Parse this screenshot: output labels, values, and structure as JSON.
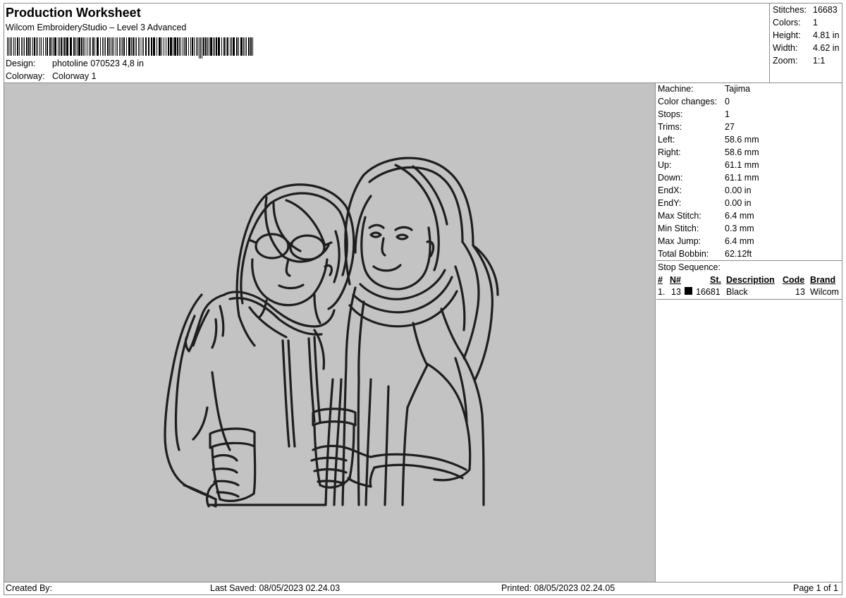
{
  "header": {
    "title": "Production Worksheet",
    "subtitle": "Wilcom EmbroideryStudio – Level 3 Advanced",
    "design_label": "Design:",
    "design_value": "photoline 070523 4,8 in",
    "colorway_label": "Colorway:",
    "colorway_value": "Colorway 1"
  },
  "summary": [
    {
      "label": "Stitches:",
      "value": "16683"
    },
    {
      "label": "Colors:",
      "value": "1"
    },
    {
      "label": "Height:",
      "value": "4.81 in"
    },
    {
      "label": "Width:",
      "value": "4.62 in"
    },
    {
      "label": "Zoom:",
      "value": "1:1"
    }
  ],
  "machine_info": [
    {
      "label": "Machine:",
      "value": "Tajima"
    },
    {
      "label": "Color changes:",
      "value": "0"
    },
    {
      "label": "Stops:",
      "value": "1"
    },
    {
      "label": "Trims:",
      "value": "27"
    },
    {
      "label": "Left:",
      "value": "58.6 mm"
    },
    {
      "label": "Right:",
      "value": "58.6 mm"
    },
    {
      "label": "Up:",
      "value": "61.1 mm"
    },
    {
      "label": "Down:",
      "value": "61.1 mm"
    },
    {
      "label": "EndX:",
      "value": "0.00 in"
    },
    {
      "label": "EndY:",
      "value": "0.00 in"
    },
    {
      "label": "Max Stitch:",
      "value": "6.4 mm"
    },
    {
      "label": "Min Stitch:",
      "value": "0.3 mm"
    },
    {
      "label": "Max Jump:",
      "value": "6.4 mm"
    },
    {
      "label": "Total Bobbin:",
      "value": "62.12ft"
    }
  ],
  "stop_sequence": {
    "title": "Stop Sequence:",
    "headers": {
      "num": "#",
      "n": "N#",
      "st": "St.",
      "description": "Description",
      "code": "Code",
      "brand": "Brand"
    },
    "rows": [
      {
        "num": "1.",
        "n": "13",
        "swatch_color": "#000000",
        "st": "16681",
        "description": "Black",
        "code": "13",
        "brand": "Wilcom"
      }
    ]
  },
  "footer": {
    "created_by": "Created By:",
    "last_saved": "Last Saved: 08/05/2023 02.24.03",
    "printed": "Printed: 08/05/2023 02.24.05",
    "page": "Page 1 of 1"
  },
  "colors": {
    "canvas_background": "#c3c3c3",
    "thread": "#1e1e1e",
    "border": "#8c8c8c"
  }
}
